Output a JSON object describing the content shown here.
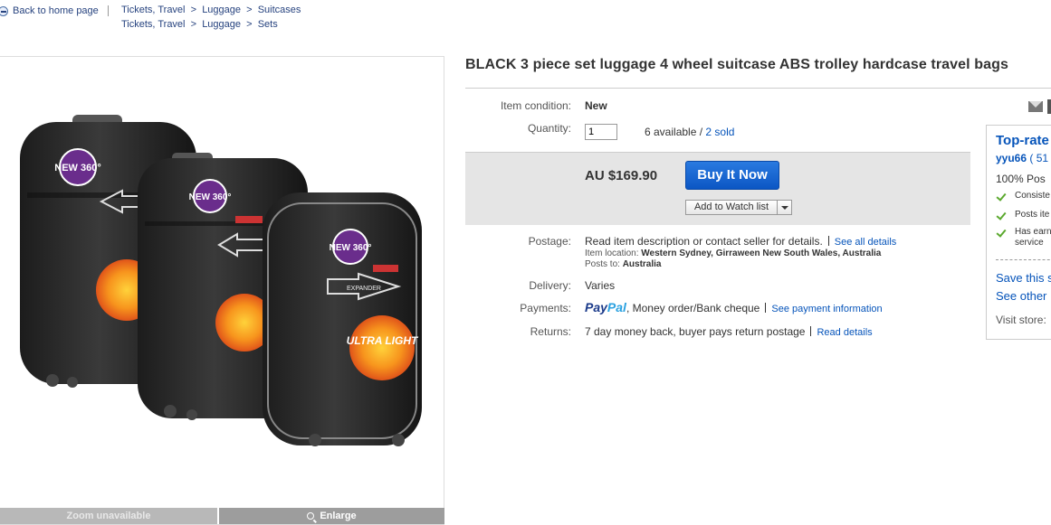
{
  "nav": {
    "back_label": "Back to home page",
    "breadcrumb_row1": [
      "Tickets, Travel",
      ">",
      "Luggage",
      ">",
      "Suitcases"
    ],
    "breadcrumb_row2": [
      "Tickets, Travel",
      ">",
      "Luggage",
      ">",
      "Sets"
    ]
  },
  "image": {
    "zoom_label": "Zoom unavailable",
    "enlarge_label": "Enlarge",
    "sticker_text": "NEW 360°",
    "expander_text": "EXPANDER",
    "ultra_text": "ULTRA LIGHT"
  },
  "item": {
    "title": "BLACK 3 piece set luggage 4 wheel suitcase ABS trolley hardcase travel bags",
    "condition_label": "Item condition:",
    "condition_value": "New",
    "quantity_label": "Quantity:",
    "quantity_value": "1",
    "available_text": "6 available /",
    "sold_link": "2 sold",
    "price": "AU $169.90",
    "buy_button": "Buy It Now",
    "watch_button": "Add to Watch list",
    "postage_label": "Postage:",
    "postage_text": "Read item description or contact seller for details.",
    "postage_link": "See all details",
    "location_label": "Item location:",
    "location_value": "Western Sydney, Girraween New South Wales, Australia",
    "posts_to_label": "Posts to:",
    "posts_to_value": "Australia",
    "delivery_label": "Delivery:",
    "delivery_value": "Varies",
    "payments_label": "Payments:",
    "paypal_a": "Pay",
    "paypal_b": "Pal",
    "payments_text": ", Money order/Bank cheque",
    "payments_link": "See payment information",
    "returns_label": "Returns:",
    "returns_text": "7 day money back, buyer pays return postage",
    "returns_link": "Read details"
  },
  "seller": {
    "badge": "Top-rate",
    "username": "yyu66",
    "feedback": " ( 51",
    "positive": "100% Pos",
    "checks": [
      "Consiste",
      "Posts ite",
      "Has earn",
      "service"
    ],
    "save_link": "Save this s",
    "other_link": "See other",
    "visit": "Visit store:"
  },
  "colors": {
    "link": "#0654ba",
    "buy_button": "#0b56c4",
    "buybox_bg": "#e5e5e5"
  }
}
